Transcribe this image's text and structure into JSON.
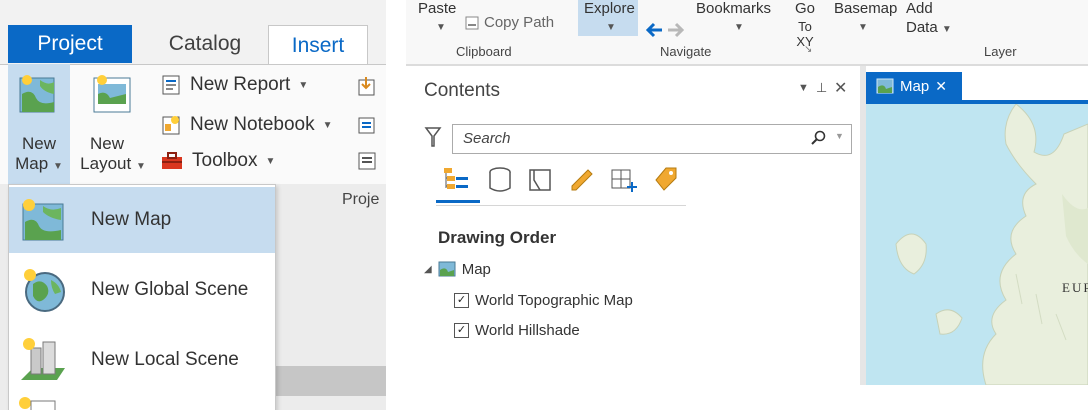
{
  "left": {
    "tabs": [
      {
        "label": "Project"
      },
      {
        "label": "Catalog"
      },
      {
        "label": "Insert"
      }
    ],
    "ribbon": {
      "new_map": {
        "line1": "New",
        "line2": "Map"
      },
      "new_layout": {
        "line1": "New",
        "line2": "Layout"
      },
      "new_report": "New Report",
      "new_notebook": "New Notebook",
      "toolbox": "Toolbox",
      "group_label": "Proje"
    },
    "dropdown": [
      {
        "label": "New Map"
      },
      {
        "label": "New Global Scene"
      },
      {
        "label": "New Local Scene"
      }
    ]
  },
  "right": {
    "ribbon": {
      "paste": "Paste",
      "copy_path": "Copy Path",
      "clipboard_label": "Clipboard",
      "explore": "Explore",
      "bookmarks": "Bookmarks",
      "go_to_xy_1": "Go",
      "go_to_xy_2": "To XY",
      "navigate_label": "Navigate",
      "basemap": "Basemap",
      "add_data_1": "Add",
      "add_data_2": "Data",
      "layer_label": "Layer"
    },
    "contents": {
      "title": "Contents",
      "search_placeholder": "Search",
      "drawing_order": "Drawing Order",
      "map_node": "Map",
      "layers": [
        {
          "name": "World Topographic Map",
          "checked": true
        },
        {
          "name": "World Hillshade",
          "checked": true
        }
      ]
    },
    "map_view": {
      "tab_label": "Map",
      "map_label": "EUR"
    }
  },
  "colors": {
    "accent": "#0a69c6",
    "selection": "#c6dcef",
    "water": "#bfe5f1",
    "land": "#e9efdd"
  }
}
